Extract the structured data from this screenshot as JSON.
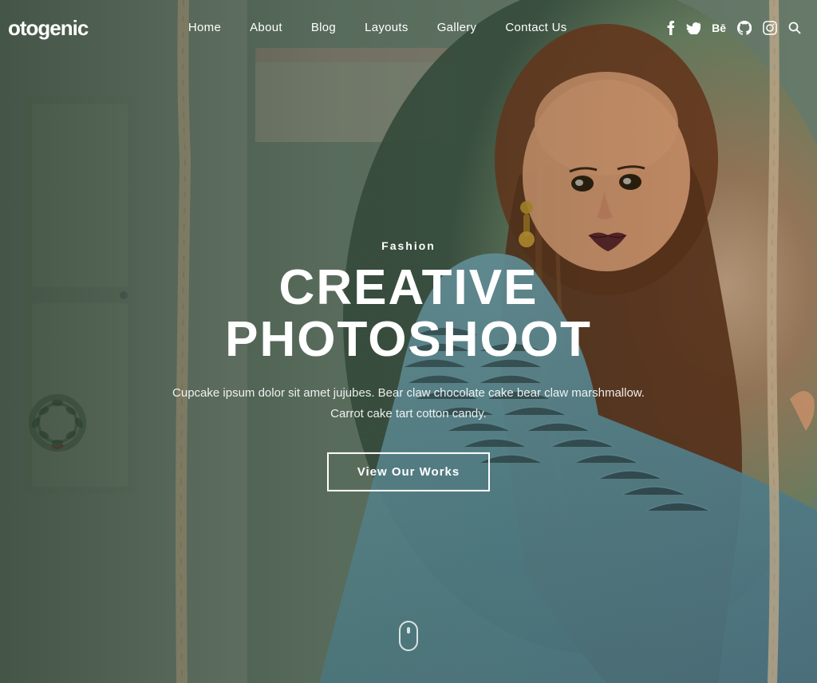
{
  "brand": {
    "name": "otogenic",
    "full_name": "Photogenic"
  },
  "navbar": {
    "links": [
      {
        "label": "Home",
        "href": "#"
      },
      {
        "label": "About",
        "href": "#"
      },
      {
        "label": "Blog",
        "href": "#"
      },
      {
        "label": "Layouts",
        "href": "#"
      },
      {
        "label": "Gallery",
        "href": "#"
      },
      {
        "label": "Contact Us",
        "href": "#"
      }
    ],
    "social": [
      {
        "name": "facebook",
        "icon": "f",
        "unicode": "𝐟"
      },
      {
        "name": "twitter",
        "icon": "𝕥",
        "unicode": "🐦"
      },
      {
        "name": "behance",
        "icon": "Bē"
      },
      {
        "name": "github",
        "icon": "⊙"
      },
      {
        "name": "instagram",
        "icon": "⬜"
      },
      {
        "name": "search",
        "icon": "🔍"
      }
    ]
  },
  "hero": {
    "category": "Fashion",
    "title": "CREATIVE PHOTOSHOOT",
    "description": "Cupcake ipsum dolor sit amet jujubes. Bear claw chocolate cake bear claw marshmallow. Carrot cake tart cotton candy.",
    "cta_label": "View Our Works",
    "scroll_hint": "scroll"
  },
  "colors": {
    "white": "#ffffff",
    "overlay": "rgba(30,50,35,0.5)",
    "accent": "#ffffff"
  }
}
